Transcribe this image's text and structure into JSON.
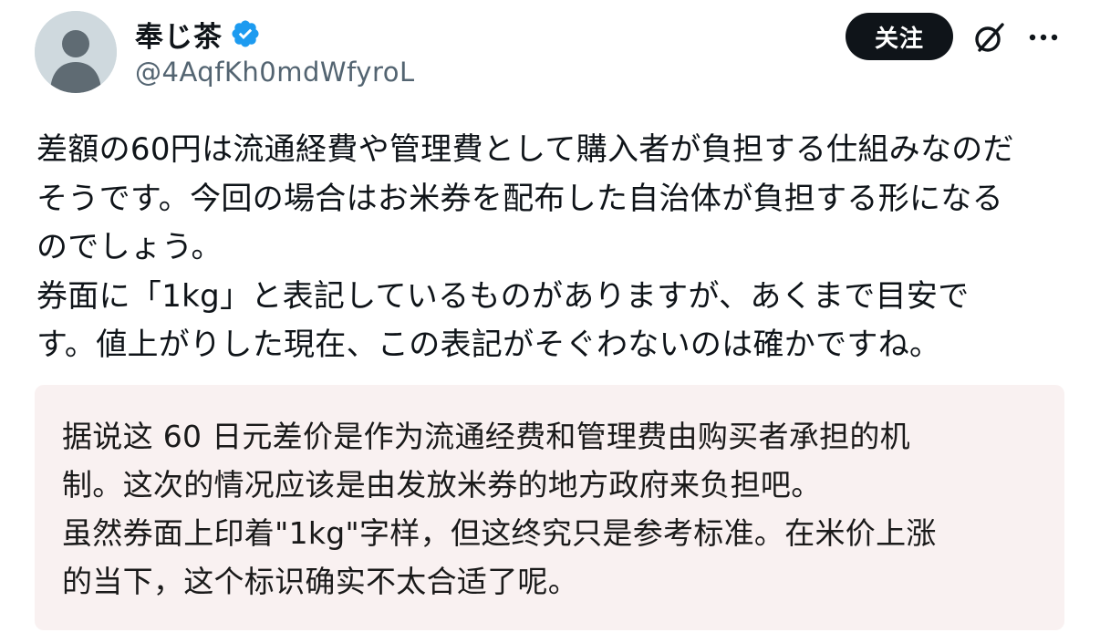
{
  "tweet": {
    "author": {
      "display_name": "奉じ茶",
      "handle": "@4AqfKh0mdWfyroL",
      "verified": true,
      "avatar_icon": "default-avatar-icon",
      "verified_color": "#1d9bf0"
    },
    "actions": {
      "follow_label": "关注",
      "grok_icon": "grok-icon",
      "more_icon": "more-options-icon"
    },
    "text": "差額の60円は流通経費や管理費として購入者が負担する仕組みなのだ\nそうです。今回の場合はお米券を配布した自治体が負担する形になる\nのでしょう。\n券面に「1kg」と表記しているものがありますが、あくまで目安で\nす。値上がりした現在、この表記がそぐわないのは確かですね。",
    "translation": "据说这 60 日元差价是作为流通经费和管理费由购买者承担的机\n制。这次的情况应该是由发放米券的地方政府来负担吧。\n虽然券面上印着\"1kg\"字样，但这终究只是参考标准。在米价上涨\n的当下，这个标识确实不太合适了呢。"
  },
  "colors": {
    "follow_button_bg": "#0f1419",
    "handle_text": "#536471",
    "translation_bg": "#f9f1f1"
  }
}
